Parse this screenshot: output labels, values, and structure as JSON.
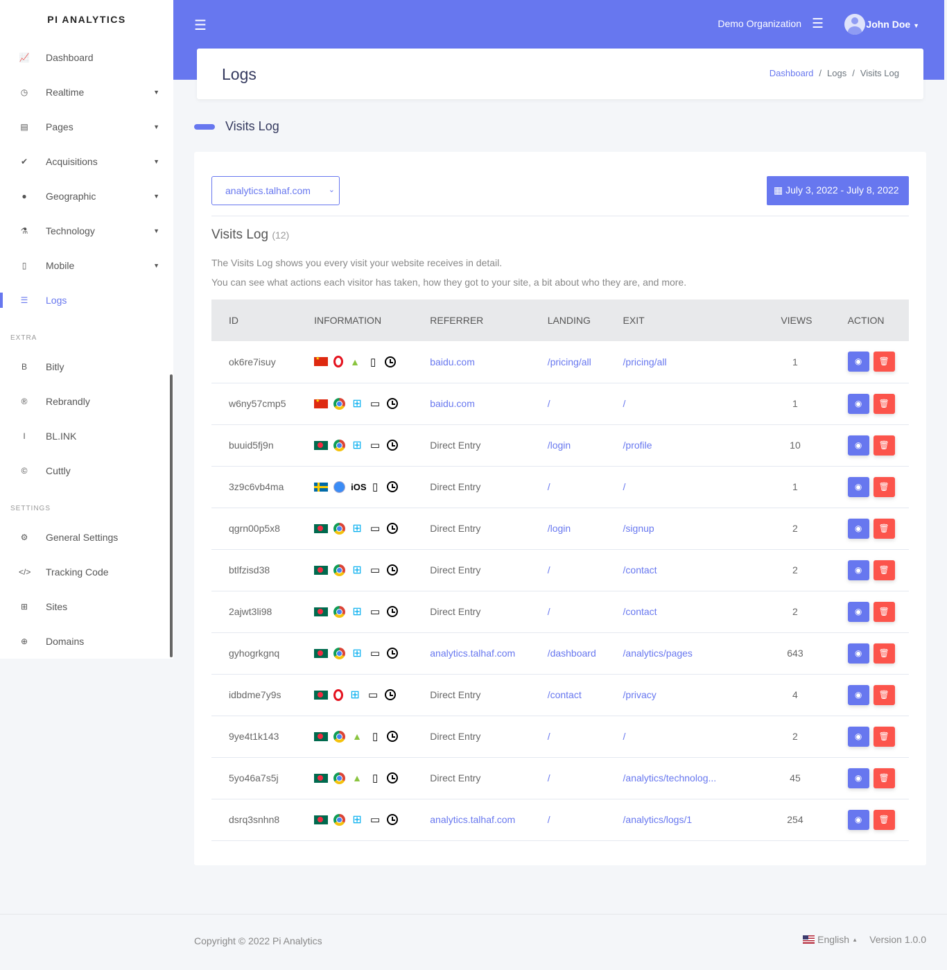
{
  "brand": "PI ANALYTICS",
  "sidebar": {
    "items": [
      {
        "label": "Dashboard",
        "icon": "📈",
        "caret": false
      },
      {
        "label": "Realtime",
        "icon": "◷",
        "caret": true
      },
      {
        "label": "Pages",
        "icon": "▤",
        "caret": true
      },
      {
        "label": "Acquisitions",
        "icon": "✔",
        "caret": true
      },
      {
        "label": "Geographic",
        "icon": "●",
        "caret": true
      },
      {
        "label": "Technology",
        "icon": "⚗",
        "caret": true
      },
      {
        "label": "Mobile",
        "icon": "▯",
        "caret": true
      },
      {
        "label": "Logs",
        "icon": "☰",
        "caret": false,
        "active": true
      }
    ],
    "extra_heading": "EXTRA",
    "extra": [
      {
        "label": "Bitly",
        "icon": "B"
      },
      {
        "label": "Rebrandly",
        "icon": "®"
      },
      {
        "label": "BL.INK",
        "icon": "I"
      },
      {
        "label": "Cuttly",
        "icon": "©"
      }
    ],
    "settings_heading": "SETTINGS",
    "settings": [
      {
        "label": "General Settings",
        "icon": "⚙"
      },
      {
        "label": "Tracking Code",
        "icon": "</>"
      },
      {
        "label": "Sites",
        "icon": "⊞"
      },
      {
        "label": "Domains",
        "icon": "⊕"
      }
    ]
  },
  "topbar": {
    "organization": "Demo Organization",
    "user": "John Doe"
  },
  "header": {
    "title": "Logs",
    "breadcrumb": [
      "Dashboard",
      "Logs",
      "Visits Log"
    ]
  },
  "section_title": "Visits Log",
  "card": {
    "site_select": "analytics.talhaf.com",
    "date_range": "July 3, 2022 - July 8, 2022",
    "title": "Visits Log",
    "count": "(12)",
    "desc1": "The Visits Log shows you every visit your website receives in detail.",
    "desc2": "You can see what actions each visitor has taken, how they got to your site, a bit about who they are, and more.",
    "columns": [
      "ID",
      "INFORMATION",
      "REFERRER",
      "LANDING",
      "EXIT",
      "VIEWS",
      "ACTION"
    ],
    "rows": [
      {
        "id": "ok6re7isuy",
        "flag": "cn",
        "browser": "opera",
        "os": "android",
        "device": "mobile",
        "referrer": "baidu.com",
        "landing": "/pricing/all",
        "exit": "/pricing/all",
        "views": "1"
      },
      {
        "id": "w6ny57cmp5",
        "flag": "cn",
        "browser": "chrome",
        "os": "windows",
        "device": "desktop",
        "referrer": "baidu.com",
        "landing": "/",
        "exit": "/",
        "views": "1"
      },
      {
        "id": "buuid5fj9n",
        "flag": "bd",
        "browser": "chrome",
        "os": "windows",
        "device": "desktop",
        "referrer": "Direct Entry",
        "landing": "/login",
        "exit": "/profile",
        "views": "10"
      },
      {
        "id": "3z9c6vb4ma",
        "flag": "se",
        "browser": "safari",
        "os": "ios",
        "device": "mobile",
        "referrer": "Direct Entry",
        "landing": "/",
        "exit": "/",
        "views": "1"
      },
      {
        "id": "qgrn00p5x8",
        "flag": "bd",
        "browser": "chrome",
        "os": "windows",
        "device": "desktop",
        "referrer": "Direct Entry",
        "landing": "/login",
        "exit": "/signup",
        "views": "2"
      },
      {
        "id": "btlfzisd38",
        "flag": "bd",
        "browser": "chrome",
        "os": "windows",
        "device": "desktop",
        "referrer": "Direct Entry",
        "landing": "/",
        "exit": "/contact",
        "views": "2"
      },
      {
        "id": "2ajwt3li98",
        "flag": "bd",
        "browser": "chrome",
        "os": "windows",
        "device": "desktop",
        "referrer": "Direct Entry",
        "landing": "/",
        "exit": "/contact",
        "views": "2"
      },
      {
        "id": "gyhogrkgnq",
        "flag": "bd",
        "browser": "chrome",
        "os": "windows",
        "device": "desktop",
        "referrer": "analytics.talhaf.com",
        "landing": "/dashboard",
        "exit": "/analytics/pages",
        "views": "643"
      },
      {
        "id": "idbdme7y9s",
        "flag": "bd",
        "browser": "opera",
        "os": "windows",
        "device": "desktop",
        "referrer": "Direct Entry",
        "landing": "/contact",
        "exit": "/privacy",
        "views": "4"
      },
      {
        "id": "9ye4t1k143",
        "flag": "bd",
        "browser": "chrome",
        "os": "android",
        "device": "mobile",
        "referrer": "Direct Entry",
        "landing": "/",
        "exit": "/",
        "views": "2"
      },
      {
        "id": "5yo46a7s5j",
        "flag": "bd",
        "browser": "chrome",
        "os": "android",
        "device": "mobile",
        "referrer": "Direct Entry",
        "landing": "/",
        "exit": "/analytics/technolog...",
        "views": "45"
      },
      {
        "id": "dsrq3snhn8",
        "flag": "bd",
        "browser": "chrome",
        "os": "windows",
        "device": "desktop",
        "referrer": "analytics.talhaf.com",
        "landing": "/",
        "exit": "/analytics/logs/1",
        "views": "254"
      }
    ]
  },
  "footer": {
    "copyright": "Copyright © 2022 Pi Analytics",
    "language": "English",
    "version": "Version 1.0.0"
  },
  "colors": {
    "accent": "#6777ef",
    "danger": "#fc544b"
  }
}
